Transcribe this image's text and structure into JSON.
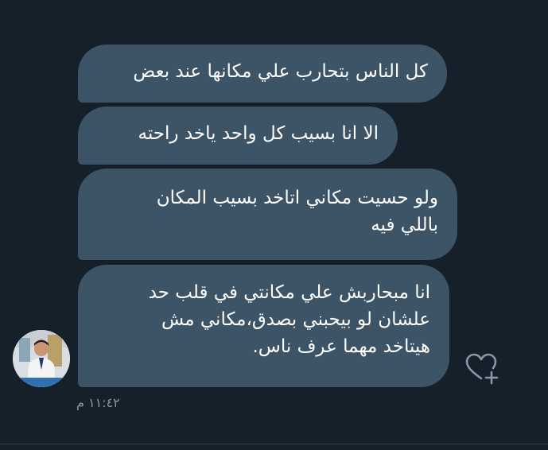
{
  "conversation": {
    "messages": [
      {
        "lines": [
          "كل الناس بتحارب علي مكانها عند بعض"
        ]
      },
      {
        "lines": [
          "الا انا بسيب كل واحد ياخد راحته"
        ]
      },
      {
        "lines": [
          "ولو حسيت مكاني اتاخد بسيب المكان",
          "باللي فيه"
        ]
      },
      {
        "lines": [
          "انا مبحاربش علي مكانتي في قلب حد",
          "علشان لو بيحبني بصدق،مكاني مش",
          "هيتاخد مهما عرف ناس."
        ]
      }
    ],
    "timestamp": "١١:٤٢ م",
    "react_icon": "heart-plus-icon",
    "avatar_icon": "profile-avatar",
    "colors": {
      "background": "#15202b",
      "bubble": "#3d5466",
      "text": "#ffffff",
      "muted": "#8899a6"
    }
  }
}
